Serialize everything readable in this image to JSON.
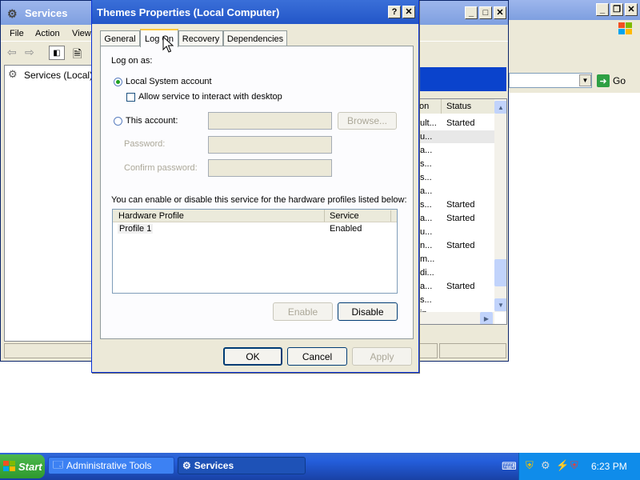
{
  "services_window": {
    "title": "Services",
    "menu": [
      "File",
      "Action",
      "View"
    ],
    "tree_root": "Services (Local)",
    "address_go": "Go",
    "columns": {
      "name_partial": "on",
      "status": "Status"
    },
    "rows": [
      {
        "name": "ult...",
        "status": "Started"
      },
      {
        "name": "u...",
        "status": ""
      },
      {
        "name": "a...",
        "status": ""
      },
      {
        "name": "s...",
        "status": ""
      },
      {
        "name": "s...",
        "status": ""
      },
      {
        "name": "a...",
        "status": ""
      },
      {
        "name": "s...",
        "status": "Started"
      },
      {
        "name": "a...",
        "status": "Started"
      },
      {
        "name": "u...",
        "status": ""
      },
      {
        "name": "n...",
        "status": "Started"
      },
      {
        "name": "m...",
        "status": ""
      },
      {
        "name": "di...",
        "status": ""
      },
      {
        "name": "a...",
        "status": "Started"
      },
      {
        "name": "s...",
        "status": ""
      },
      {
        "name": "in...",
        "status": ""
      }
    ]
  },
  "dialog": {
    "title": "Themes Properties (Local Computer)",
    "tabs": [
      "General",
      "Log On",
      "Recovery",
      "Dependencies"
    ],
    "log_on_as": "Log on as:",
    "local_system": "Local System account",
    "allow_interact": "Allow service to interact with desktop",
    "this_account": "This account:",
    "browse": "Browse...",
    "password": "Password:",
    "confirm_password": "Confirm password:",
    "hw_description": "You can enable or disable this service for the hardware profiles listed below:",
    "hw_columns": {
      "profile": "Hardware Profile",
      "service": "Service"
    },
    "hw_rows": [
      {
        "profile": "Profile 1",
        "service": "Enabled"
      }
    ],
    "enable": "Enable",
    "disable": "Disable",
    "ok": "OK",
    "cancel": "Cancel",
    "apply": "Apply"
  },
  "taskbar": {
    "start": "Start",
    "items": [
      "Administrative Tools",
      "Services"
    ],
    "clock": "6:23 PM"
  }
}
